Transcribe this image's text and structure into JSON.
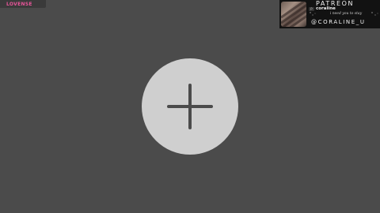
{
  "lovense": {
    "label": "LOVENSE",
    "color": "#e8559a"
  },
  "patreon": {
    "title": "PATREON",
    "creator": "coraline",
    "tagline": "i need you to stay",
    "handle": "@CORALINE_U"
  },
  "main": {
    "add_icon": "plus-icon",
    "background_color": "#4b4b4b",
    "button_color": "#cfcfcf",
    "icon_color": "#4b4b4b"
  }
}
